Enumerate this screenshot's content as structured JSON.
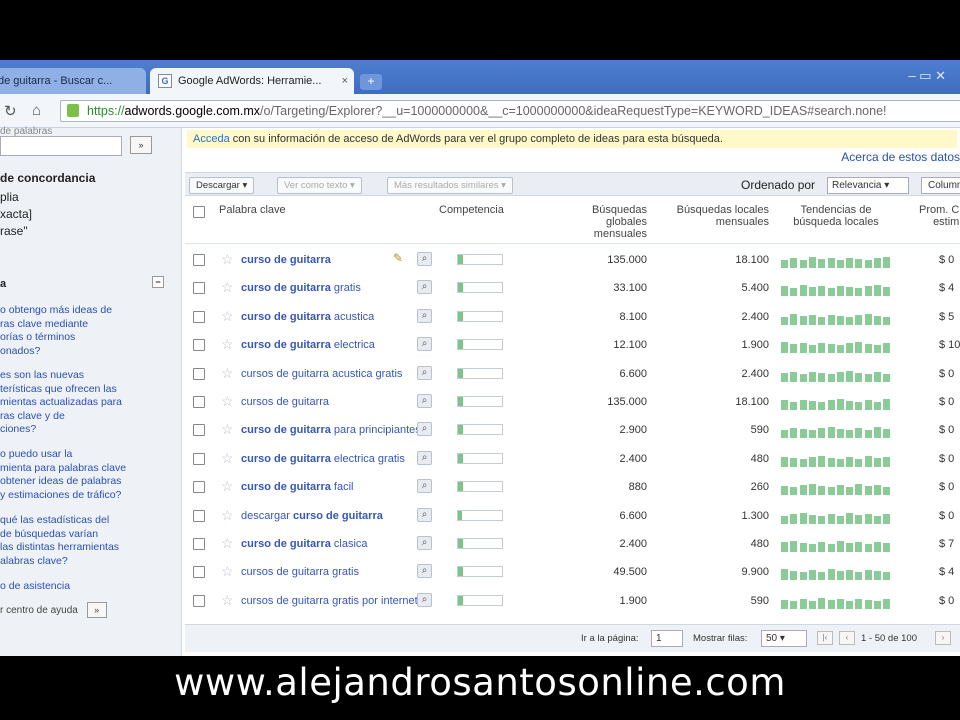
{
  "browser": {
    "tabs": [
      {
        "label": "de guitarra - Buscar c..."
      },
      {
        "label": "Google AdWords: Herramie...",
        "favicon": "G"
      }
    ],
    "close_glyph": "×",
    "new_tab_glyph": "+",
    "window_controls": "–   ▭   ✕",
    "url_scheme": "https://",
    "url_domain": "adwords.google.com.mx",
    "url_rest": "/o/Targeting/Explorer?__u=1000000000&__c=1000000000&ideaRequestType=KEYWORD_IDEAS#search.none!"
  },
  "sidebar": {
    "section_label": "de palabras",
    "go_label": "»",
    "match_title": "de concordancia",
    "match_options": [
      "plia",
      "xacta]",
      "rase\""
    ],
    "help_title": "a",
    "help_min": "−",
    "help_links": [
      "o obtengo más ideas de\nras clave mediante\norías o términos\nonados?",
      "es son las nuevas\nterísticas que ofrecen las\nmientas actualizadas para\nras clave y de\nciones?",
      "o puedo usar la\nmienta para palabras clave\nobtener ideas de palabras\ny estimaciones de tráfico?",
      "qué las estadísticas del\nde búsquedas varían\nlas distintas herramientas\nalabras clave?",
      "o de asistencia"
    ],
    "footer_text": "r centro de ayuda",
    "footer_btn": "»"
  },
  "main": {
    "notice_link": "Acceda",
    "notice_text": " con su información de acceso de AdWords para ver el grupo completo de ideas para esta búsqueda.",
    "about_link": "Acerca de estos datos",
    "actions": {
      "download": "Descargar ▾",
      "view_text": "Ver como texto ▾",
      "more_like": "Más resultados similares ▾"
    },
    "sort_label": "Ordenado por",
    "sort_value": "Relevancia ▾",
    "columns_btn": "Column",
    "headers": {
      "keyword": "Palabra clave",
      "competition": "Competencia",
      "global": "Búsquedas\nglobales\nmensuales",
      "local": "Búsquedas locales\nmensuales",
      "trends": "Tendencias de\nbúsqueda locales",
      "cpc": "Prom. C\nestim"
    },
    "rows": [
      {
        "pre": "",
        "bold": "curso de guitarra",
        "post": "",
        "competition": 0.12,
        "global": "135.000",
        "local": "18.100",
        "cpc": "$ 0",
        "edit": true
      },
      {
        "pre": "",
        "bold": "curso de guitarra",
        "post": " gratis",
        "competition": 0.12,
        "global": "33.100",
        "local": "5.400",
        "cpc": "$ 4"
      },
      {
        "pre": "",
        "bold": "curso de guitarra",
        "post": " acustica",
        "competition": 0.12,
        "global": "8.100",
        "local": "2.400",
        "cpc": "$ 5"
      },
      {
        "pre": "",
        "bold": "curso de guitarra",
        "post": " electrica",
        "competition": 0.12,
        "global": "12.100",
        "local": "1.900",
        "cpc": "$ 10"
      },
      {
        "pre": "cursos de guitarra acustica gratis",
        "bold": "",
        "post": "",
        "competition": 0.12,
        "global": "6.600",
        "local": "2.400",
        "cpc": "$ 0"
      },
      {
        "pre": "cursos de guitarra",
        "bold": "",
        "post": "",
        "competition": 0.12,
        "global": "135.000",
        "local": "18.100",
        "cpc": "$ 0"
      },
      {
        "pre": "",
        "bold": "curso de guitarra",
        "post": " para principiantes",
        "competition": 0.12,
        "global": "2.900",
        "local": "590",
        "cpc": "$ 0"
      },
      {
        "pre": "",
        "bold": "curso de guitarra",
        "post": " electrica gratis",
        "competition": 0.12,
        "global": "2.400",
        "local": "480",
        "cpc": "$ 0"
      },
      {
        "pre": "",
        "bold": "curso de guitarra",
        "post": " facil",
        "competition": 0.12,
        "global": "880",
        "local": "260",
        "cpc": "$ 0"
      },
      {
        "pre": "descargar ",
        "bold": "curso de guitarra",
        "post": "",
        "competition": 0.08,
        "global": "6.600",
        "local": "1.300",
        "cpc": "$ 0"
      },
      {
        "pre": "",
        "bold": "curso de guitarra",
        "post": " clasica",
        "competition": 0.12,
        "global": "2.400",
        "local": "480",
        "cpc": "$ 7"
      },
      {
        "pre": "cursos de guitarra gratis",
        "bold": "",
        "post": "",
        "competition": 0.12,
        "global": "49.500",
        "local": "9.900",
        "cpc": "$ 4"
      },
      {
        "pre": "cursos de guitarra gratis por internet",
        "bold": "",
        "post": "",
        "competition": 0.12,
        "global": "1.900",
        "local": "590",
        "cpc": "$ 0"
      }
    ],
    "pager": {
      "goto_label": "Ir a la página:",
      "page_value": "1",
      "rows_label": "Mostrar filas:",
      "rows_value": "50",
      "range": "1 - 50 de 100"
    }
  },
  "caption": "www.alejandrosantosonline.com",
  "colors": {
    "tabstrip": "#3e6cc0",
    "link": "#3656b8",
    "trend_bar": "#8acb97",
    "notice_bg": "#fff9c9"
  }
}
